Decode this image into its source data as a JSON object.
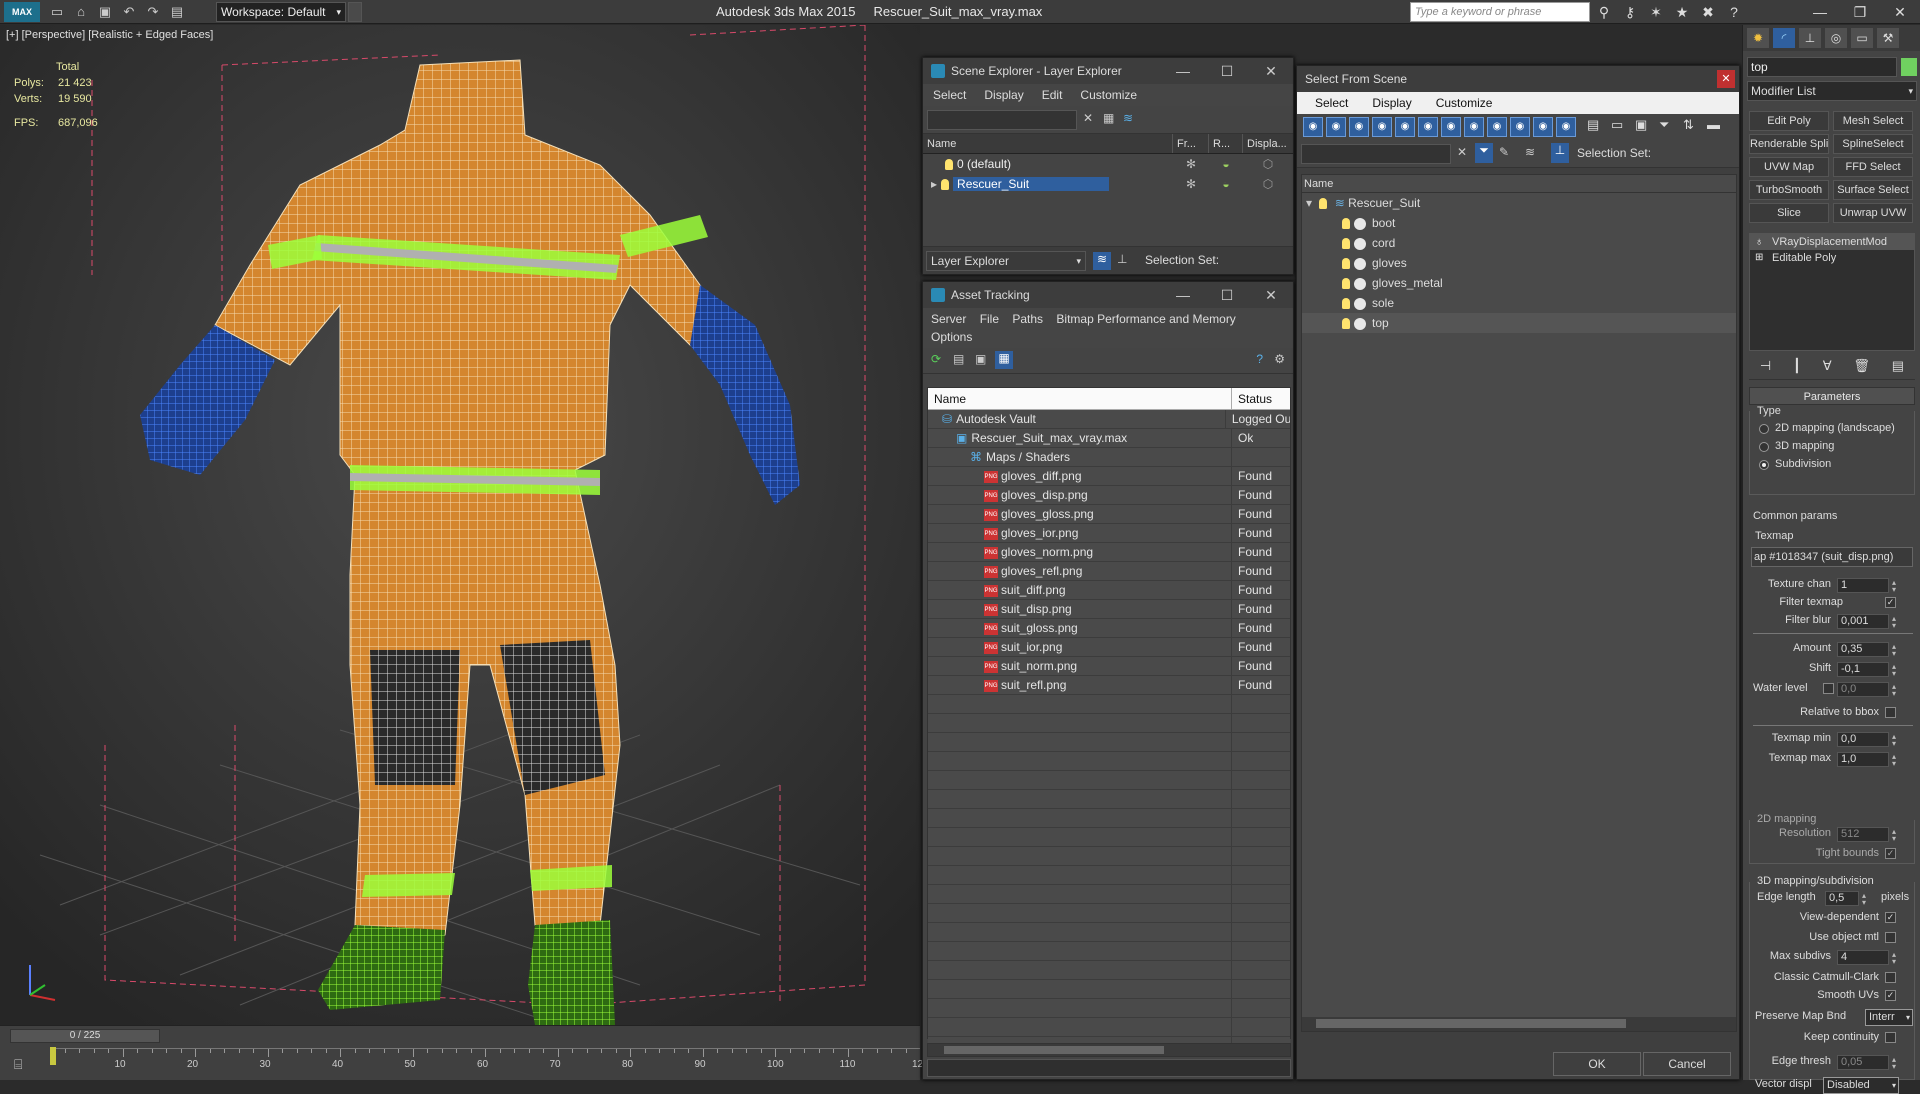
{
  "app": {
    "logo": "MAX",
    "title": "Autodesk 3ds Max  2015",
    "file": "Rescuer_Suit_max_vray.max",
    "workspace": "Workspace: Default",
    "search_placeholder": "Type a keyword or phrase"
  },
  "viewport": {
    "label": "[+] [Perspective] [Realistic + Edged Faces]",
    "stats": {
      "header": "Total",
      "polys_label": "Polys:",
      "polys": "21 423",
      "verts_label": "Verts:",
      "verts": "19 590",
      "fps_label": "FPS:",
      "fps": "687,096"
    }
  },
  "timeline": {
    "frame": "0 / 225",
    "ticks": [
      "10",
      "20",
      "30",
      "40",
      "50",
      "60",
      "70",
      "80",
      "90",
      "100",
      "110",
      "12"
    ]
  },
  "scene_explorer": {
    "title": "Scene Explorer - Layer Explorer",
    "menus": [
      "Select",
      "Display",
      "Edit",
      "Customize"
    ],
    "columns": [
      "Name",
      "Fr...",
      "R...",
      "Displa..."
    ],
    "layers": [
      {
        "name": "0 (default)",
        "selected": false
      },
      {
        "name": "Rescuer_Suit",
        "selected": true
      }
    ],
    "footer_dropdown": "Layer Explorer",
    "selection_set_label": "Selection Set:"
  },
  "asset_tracking": {
    "title": "Asset Tracking",
    "menus": [
      "Server",
      "File",
      "Paths",
      "Bitmap Performance and Memory",
      "Options"
    ],
    "columns": [
      "Name",
      "Status"
    ],
    "rows": [
      {
        "name": "Autodesk Vault",
        "status": "Logged Ou",
        "indent": 1,
        "icon": "vault-icon"
      },
      {
        "name": "Rescuer_Suit_max_vray.max",
        "status": "Ok",
        "indent": 2,
        "icon": "max-file-icon"
      },
      {
        "name": "Maps / Shaders",
        "status": "",
        "indent": 3,
        "icon": "maps-icon"
      },
      {
        "name": "gloves_diff.png",
        "status": "Found",
        "indent": 4,
        "icon": "png-icon"
      },
      {
        "name": "gloves_disp.png",
        "status": "Found",
        "indent": 4,
        "icon": "png-icon"
      },
      {
        "name": "gloves_gloss.png",
        "status": "Found",
        "indent": 4,
        "icon": "png-icon"
      },
      {
        "name": "gloves_ior.png",
        "status": "Found",
        "indent": 4,
        "icon": "png-icon"
      },
      {
        "name": "gloves_norm.png",
        "status": "Found",
        "indent": 4,
        "icon": "png-icon"
      },
      {
        "name": "gloves_refl.png",
        "status": "Found",
        "indent": 4,
        "icon": "png-icon"
      },
      {
        "name": "suit_diff.png",
        "status": "Found",
        "indent": 4,
        "icon": "png-icon"
      },
      {
        "name": "suit_disp.png",
        "status": "Found",
        "indent": 4,
        "icon": "png-icon"
      },
      {
        "name": "suit_gloss.png",
        "status": "Found",
        "indent": 4,
        "icon": "png-icon"
      },
      {
        "name": "suit_ior.png",
        "status": "Found",
        "indent": 4,
        "icon": "png-icon"
      },
      {
        "name": "suit_norm.png",
        "status": "Found",
        "indent": 4,
        "icon": "png-icon"
      },
      {
        "name": "suit_refl.png",
        "status": "Found",
        "indent": 4,
        "icon": "png-icon"
      }
    ]
  },
  "select_from_scene": {
    "title": "Select From Scene",
    "menus": [
      "Select",
      "Display",
      "Customize"
    ],
    "selection_set_label": "Selection Set:",
    "column": "Name",
    "root": "Rescuer_Suit",
    "objects": [
      {
        "name": "boot",
        "selected": false
      },
      {
        "name": "cord",
        "selected": false
      },
      {
        "name": "gloves",
        "selected": false
      },
      {
        "name": "gloves_metal",
        "selected": false
      },
      {
        "name": "sole",
        "selected": false
      },
      {
        "name": "top",
        "selected": true
      }
    ],
    "ok": "OK",
    "cancel": "Cancel"
  },
  "command_panel": {
    "object_name": "top",
    "object_color": "#70d060",
    "modifier_list": "Modifier List",
    "modifier_buttons": [
      "Edit Poly",
      "Mesh Select",
      "Renderable Spline",
      "SplineSelect",
      "UVW Map",
      "FFD Select",
      "TurboSmooth",
      "Surface Select",
      "Slice",
      "Unwrap UVW"
    ],
    "stack": [
      "VRayDisplacementMod",
      "Editable Poly"
    ],
    "params": {
      "rollout": "Parameters",
      "type_label": "Type",
      "type_options": [
        "2D mapping (landscape)",
        "3D mapping",
        "Subdivision"
      ],
      "type_selected": "Subdivision",
      "common_params": "Common params",
      "texmap_label": "Texmap",
      "texmap": "ap #1018347 (suit_disp.png)",
      "texture_chan_label": "Texture chan",
      "texture_chan": "1",
      "filter_texmap_label": "Filter texmap",
      "filter_texmap": true,
      "filter_blur_label": "Filter blur",
      "filter_blur": "0,001",
      "amount_label": "Amount",
      "amount": "0,35",
      "shift_label": "Shift",
      "shift": "-0,1",
      "water_level_label": "Water level",
      "water_level": "0,0",
      "relative_bbox_label": "Relative to bbox",
      "texmap_min_label": "Texmap min",
      "texmap_min": "0,0",
      "texmap_max_label": "Texmap max",
      "texmap_max": "1,0",
      "mapping2d_label": "2D mapping",
      "resolution_label": "Resolution",
      "resolution": "512",
      "tight_bounds_label": "Tight bounds",
      "mapping3d_label": "3D mapping/subdivision",
      "edge_length_label": "Edge length",
      "edge_length": "0,5",
      "pixels_label": "pixels",
      "view_dependent_label": "View-dependent",
      "use_object_mtl_label": "Use object mtl",
      "max_subdivs_label": "Max subdivs",
      "max_subdivs": "4",
      "classic_catmull_label": "Classic Catmull-Clark",
      "smooth_uvs_label": "Smooth UVs",
      "preserve_map_label": "Preserve Map Bnd",
      "preserve_map": "Interr",
      "keep_continuity_label": "Keep continuity",
      "edge_thresh_label": "Edge thresh",
      "edge_thresh": "0,05",
      "vector_displ_label": "Vector displ",
      "vector_displ": "Disabled"
    }
  }
}
